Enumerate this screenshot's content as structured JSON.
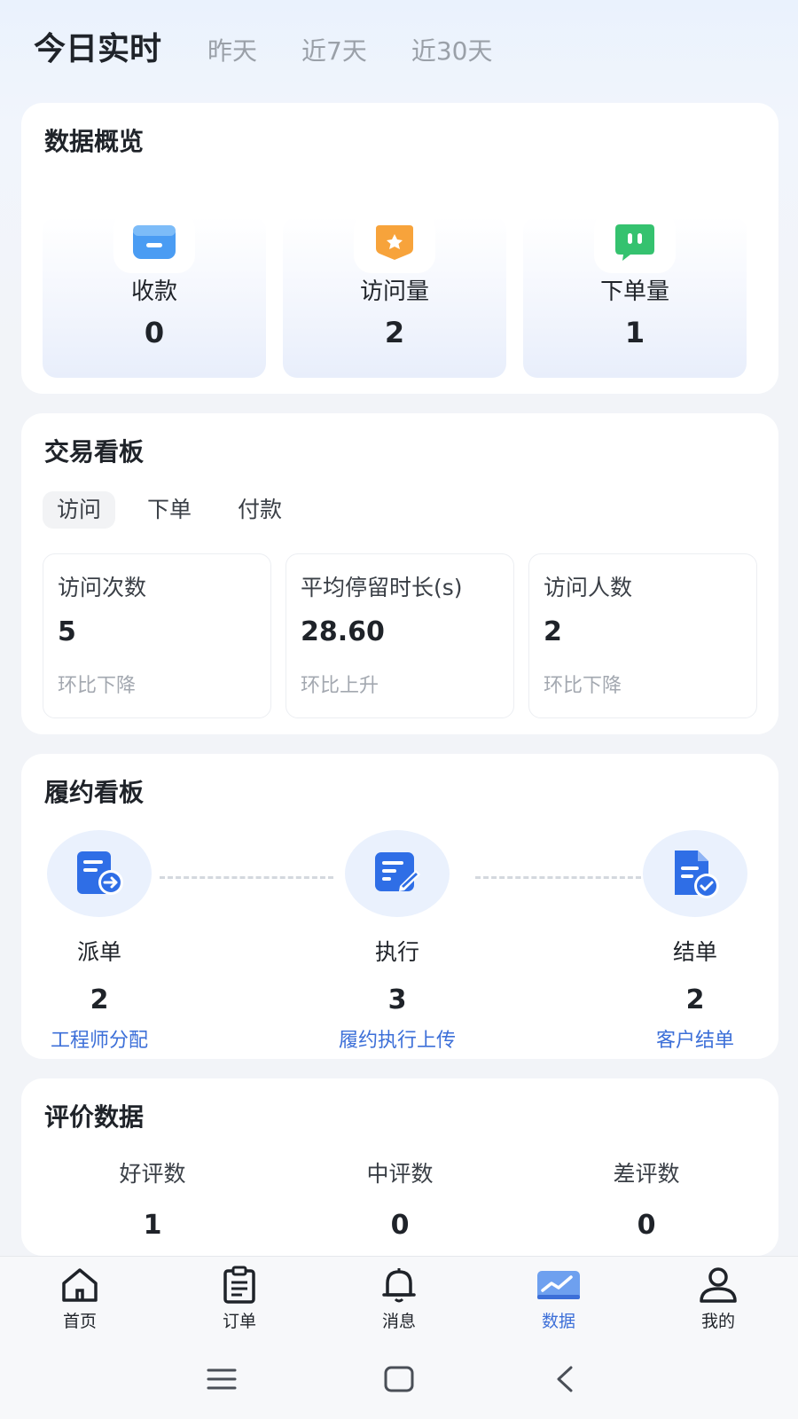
{
  "time_tabs": [
    {
      "label": "今日实时",
      "active": true
    },
    {
      "label": "昨天",
      "active": false
    },
    {
      "label": "近7天",
      "active": false
    },
    {
      "label": "近30天",
      "active": false
    }
  ],
  "overview": {
    "title": "数据概览",
    "items": [
      {
        "label": "收款",
        "value": "0",
        "icon": "wallet-icon",
        "color": "#4a9cf3"
      },
      {
        "label": "访问量",
        "value": "2",
        "icon": "star-badge-icon",
        "color": "#f7a33b"
      },
      {
        "label": "下单量",
        "value": "1",
        "icon": "chat-icon",
        "color": "#35c26f"
      }
    ]
  },
  "trade": {
    "title": "交易看板",
    "tabs": [
      {
        "label": "访问",
        "active": true
      },
      {
        "label": "下单",
        "active": false
      },
      {
        "label": "付款",
        "active": false
      }
    ],
    "metrics": [
      {
        "label": "访问次数",
        "value": "5",
        "trend": "环比下降"
      },
      {
        "label": "平均停留时长(s)",
        "value": "28.60",
        "trend": "环比上升"
      },
      {
        "label": "访问人数",
        "value": "2",
        "trend": "环比下降"
      }
    ]
  },
  "fulfillment": {
    "title": "履约看板",
    "steps": [
      {
        "name": "派单",
        "count": "2",
        "link": "工程师分配",
        "icon": "dispatch-icon"
      },
      {
        "name": "执行",
        "count": "3",
        "link": "履约执行上传",
        "icon": "edit-document-icon"
      },
      {
        "name": "结单",
        "count": "2",
        "link": "客户结单",
        "icon": "document-check-icon"
      }
    ],
    "accent": "#2f6ee6"
  },
  "reviews": {
    "title": "评价数据",
    "items": [
      {
        "label": "好评数",
        "value": "1"
      },
      {
        "label": "中评数",
        "value": "0"
      },
      {
        "label": "差评数",
        "value": "0"
      }
    ]
  },
  "bottom_nav": [
    {
      "label": "首页",
      "icon": "home-icon",
      "active": false
    },
    {
      "label": "订单",
      "icon": "clipboard-icon",
      "active": false
    },
    {
      "label": "消息",
      "icon": "bell-icon",
      "active": false
    },
    {
      "label": "数据",
      "icon": "chart-icon",
      "active": true
    },
    {
      "label": "我的",
      "icon": "user-icon",
      "active": false
    }
  ],
  "system_bar": [
    "menu-icon",
    "home-square-icon",
    "back-icon"
  ],
  "colors": {
    "accent": "#3c6fd8",
    "active_nav": "#3c6fd8"
  }
}
